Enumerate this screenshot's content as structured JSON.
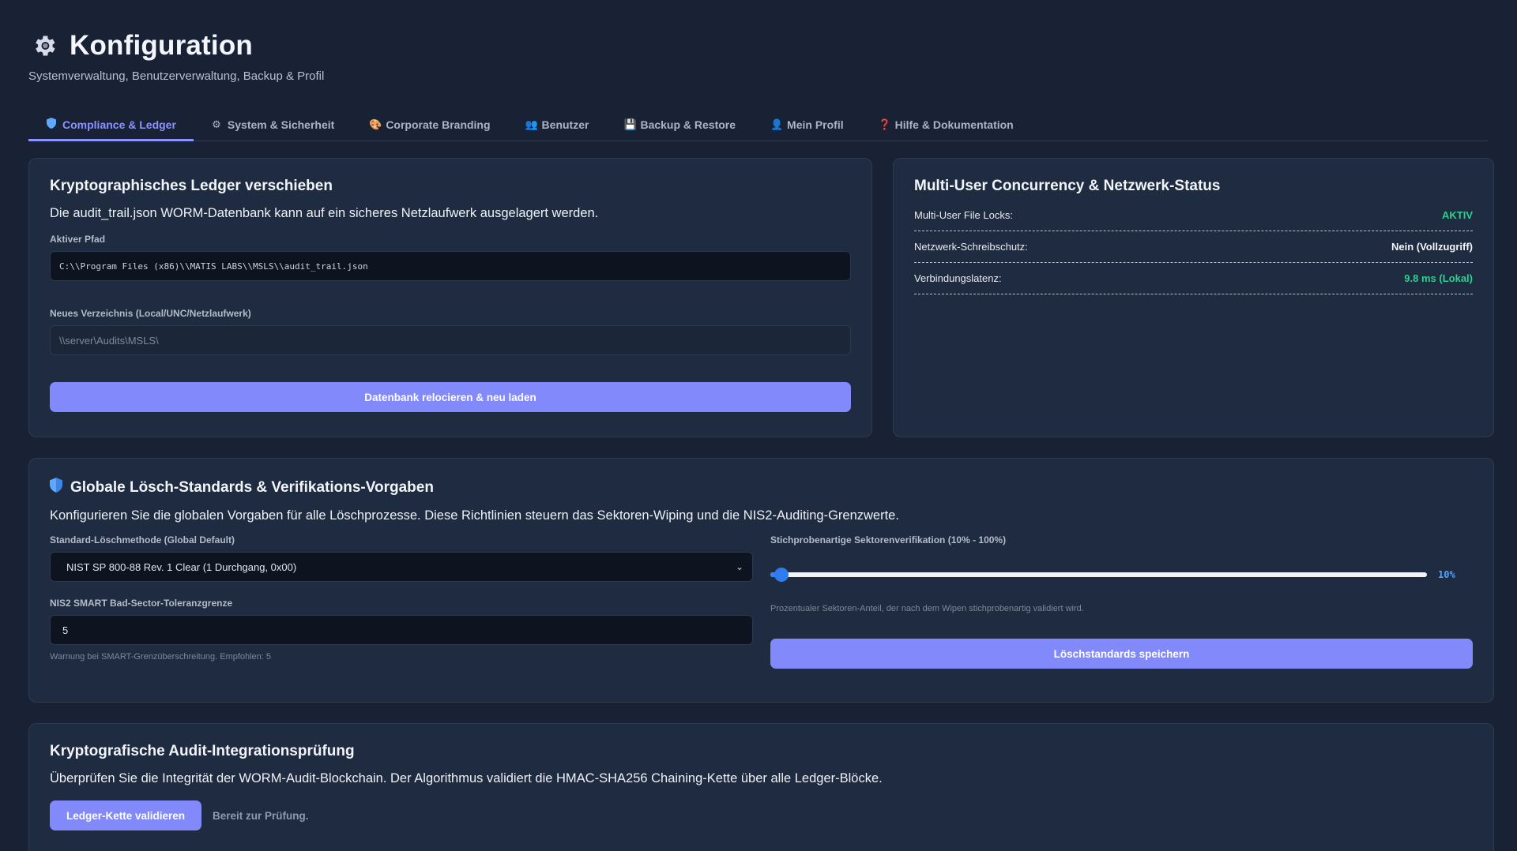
{
  "header": {
    "title": "Konfiguration",
    "subtitle": "Systemverwaltung, Benutzerverwaltung, Backup & Profil"
  },
  "tabs": [
    {
      "label": "Compliance & Ledger",
      "icon": "shield-icon",
      "glyph": "🛡"
    },
    {
      "label": "System & Sicherheit",
      "icon": "gear-icon",
      "glyph": "⚙"
    },
    {
      "label": "Corporate Branding",
      "icon": "palette-icon",
      "glyph": "🎨"
    },
    {
      "label": "Benutzer",
      "icon": "users-icon",
      "glyph": "👥"
    },
    {
      "label": "Backup & Restore",
      "icon": "floppy-disk-icon",
      "glyph": "💾"
    },
    {
      "label": "Mein Profil",
      "icon": "user-icon",
      "glyph": "👤"
    },
    {
      "label": "Hilfe & Dokumentation",
      "icon": "question-icon",
      "glyph": "❓"
    }
  ],
  "ledger": {
    "title": "Kryptographisches Ledger verschieben",
    "description": "Die audit_trail.json WORM-Datenbank kann auf ein sicheres Netzlaufwerk ausgelagert werden.",
    "active_path_label": "Aktiver Pfad",
    "active_path": "C:\\\\Program Files (x86)\\\\MATIS LABS\\\\MSLS\\\\audit_trail.json",
    "new_dir_label": "Neues Verzeichnis (Local/UNC/Netzlaufwerk)",
    "new_dir_placeholder": "\\\\server\\Audits\\MSLS\\",
    "button": "Datenbank relocieren & neu laden"
  },
  "network": {
    "title": "Multi-User Concurrency & Netzwerk-Status",
    "rows": [
      {
        "key": "Multi-User File Locks:",
        "value": "AKTIV",
        "color": "#2ecf8f"
      },
      {
        "key": "Netzwerk-Schreibschutz:",
        "value": "Nein (Vollzugriff)",
        "color": "#f3f6fb"
      },
      {
        "key": "Verbindungslatenz:",
        "value": "9.8 ms (Lokal)",
        "color": "#2ecf8f"
      }
    ]
  },
  "wipe": {
    "title": "Globale Lösch-Standards & Verifikations-Vorgaben",
    "description": "Konfigurieren Sie die globalen Vorgaben für alle Löschprozesse. Diese Richtlinien steuern das Sektoren-Wiping und die NIS2-Auditing-Grenzwerte.",
    "method_label": "Standard-Löschmethode (Global Default)",
    "method_value": "NIST SP 800-88 Rev. 1 Clear (1 Durchgang, 0x00)",
    "tolerance_label": "NIS2 SMART Bad-Sector-Toleranzgrenze",
    "tolerance_value": "5",
    "tolerance_hint": "Warnung bei SMART-Grenzüberschreitung. Empfohlen: 5",
    "verify_label": "Stichprobenartige Sektorenverifikation (10% - 100%)",
    "verify_value_text": "10%",
    "verify_percent": 10,
    "verify_min": 10,
    "verify_max": 100,
    "verify_hint": "Prozentualer Sektoren-Anteil, der nach dem Wipen stichprobenartig validiert wird.",
    "button": "Löschstandards speichern"
  },
  "audit": {
    "title": "Kryptografische Audit-Integrationsprüfung",
    "description": "Überprüfen Sie die Integrität der WORM-Audit-Blockchain. Der Algorithmus validiert die HMAC-SHA256 Chaining-Kette über alle Ledger-Blöcke.",
    "button": "Ledger-Kette validieren",
    "status": "Bereit zur Prüfung."
  },
  "colors": {
    "accent": "#8189fb",
    "success": "#2ecf8f",
    "background": "#182234",
    "card": "#1f2b40"
  }
}
